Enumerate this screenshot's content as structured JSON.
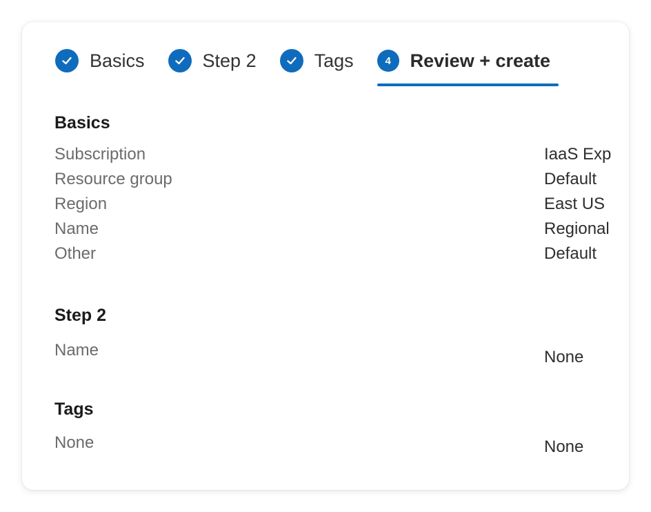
{
  "tabs": [
    {
      "label": "Basics",
      "state": "complete",
      "icon": "check-icon"
    },
    {
      "label": "Step 2",
      "state": "complete",
      "icon": "check-icon"
    },
    {
      "label": "Tags",
      "state": "complete",
      "icon": "check-icon"
    },
    {
      "label": "Review + create",
      "state": "active",
      "number": "4"
    }
  ],
  "basics": {
    "title": "Basics",
    "rows": [
      {
        "label": "Subscription",
        "value": "IaaS Exp"
      },
      {
        "label": "Resource group",
        "value": "Default"
      },
      {
        "label": "Region",
        "value": "East US"
      },
      {
        "label": "Name",
        "value": "Regional"
      },
      {
        "label": "Other",
        "value": "Default"
      }
    ]
  },
  "step2": {
    "title": "Step 2",
    "rows": [
      {
        "label": "Name",
        "value": "None"
      }
    ]
  },
  "tags": {
    "title": "Tags",
    "rows": [
      {
        "label": "None",
        "value": "None"
      }
    ]
  },
  "colors": {
    "accent": "#0f6cbd",
    "muted_text": "#6b6b6b",
    "text": "#2e2e2e"
  }
}
